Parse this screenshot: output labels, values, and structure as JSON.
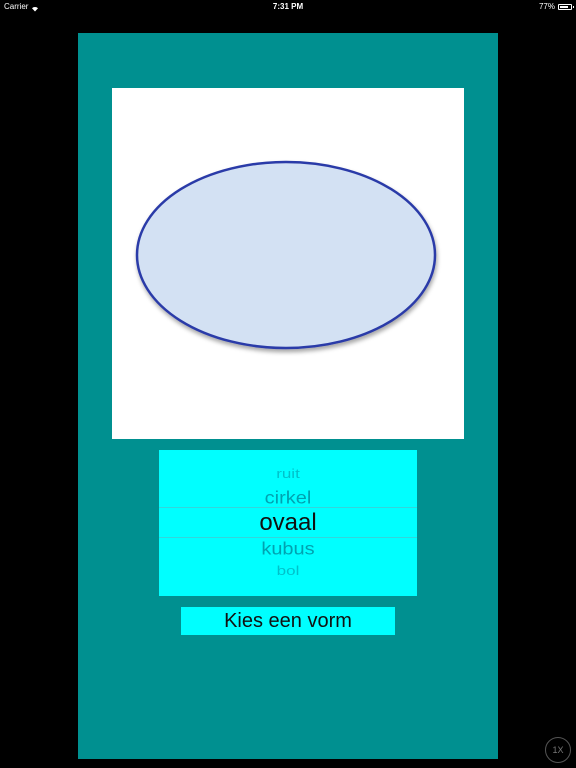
{
  "status_bar": {
    "carrier": "Carrier",
    "time": "7:31 PM",
    "battery_text": "77%",
    "battery_level": 0.77,
    "wifi_icon": "wifi-icon",
    "battery_icon": "battery-icon"
  },
  "colors": {
    "background": "#000000",
    "panel": "#009090",
    "picker_bg": "#00ffff",
    "button_bg": "#00ffff",
    "image_bg": "#ffffff",
    "ellipse_fill": "#d3e1f3",
    "ellipse_stroke": "#2a3aa8",
    "picker_line": "#33d6dc"
  },
  "picker": {
    "items": [
      {
        "label": "ruit"
      },
      {
        "label": "cirkel"
      },
      {
        "label": "ovaal"
      },
      {
        "label": "kubus"
      },
      {
        "label": "bol"
      }
    ],
    "selected_index": 2
  },
  "button": {
    "label": "Kies een vorm"
  },
  "zoom": {
    "label": "1X"
  }
}
